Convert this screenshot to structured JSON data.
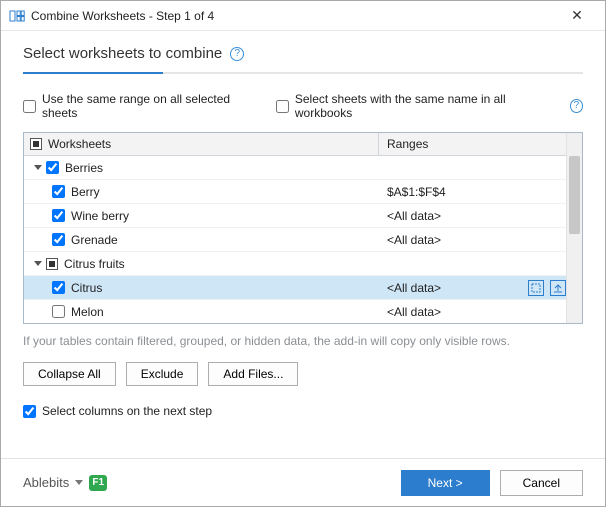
{
  "window": {
    "title": "Combine Worksheets - Step 1 of 4"
  },
  "heading": "Select worksheets to combine",
  "options": {
    "same_range": "Use the same range on all selected sheets",
    "same_name": "Select sheets with the same name in all workbooks"
  },
  "columns": {
    "worksheets": "Worksheets",
    "ranges": "Ranges"
  },
  "tree": {
    "group0": {
      "label": "Berries"
    },
    "row0": {
      "label": "Berry",
      "range": "$A$1:$F$4"
    },
    "row1": {
      "label": "Wine berry",
      "range": "<All data>"
    },
    "row2": {
      "label": "Grenade",
      "range": "<All data>"
    },
    "group1": {
      "label": "Citrus fruits"
    },
    "row3": {
      "label": "Citrus",
      "range": "<All data>"
    },
    "row4": {
      "label": "Melon",
      "range": "<All data>"
    }
  },
  "hint": "If your tables contain filtered, grouped, or hidden data, the add-in will copy only visible rows.",
  "buttons": {
    "collapse": "Collapse All",
    "exclude": "Exclude",
    "add_files": "Add Files...",
    "next": "Next >",
    "cancel": "Cancel"
  },
  "select_columns": "Select columns on the next step",
  "brand": "Ablebits",
  "f1": "F1"
}
